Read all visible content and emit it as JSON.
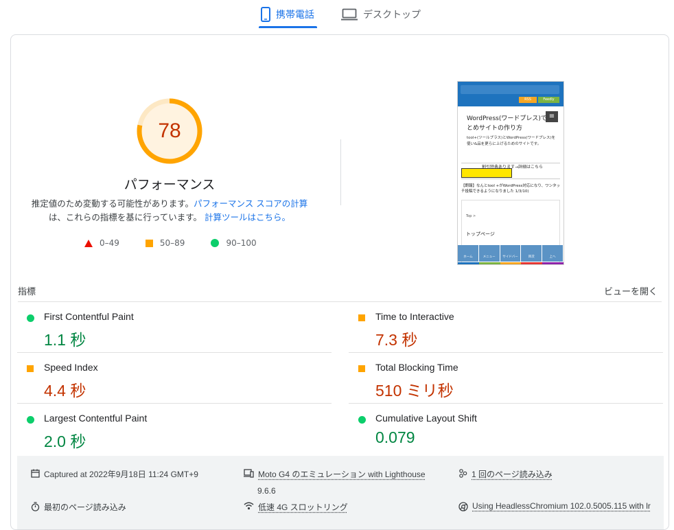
{
  "tabs": {
    "mobile": "携帯電話",
    "desktop": "デスクトップ"
  },
  "performance": {
    "score": "78",
    "score_value": 78,
    "title": "パフォーマンス",
    "desc_1": "推定値のため変動する可能性があります。",
    "desc_link_1": "パフォーマンス スコアの計算",
    "desc_2": "は、これらの指標を基に行っています。",
    "desc_link_2": "計算ツールはこちら。",
    "legend": [
      {
        "range": "0–49"
      },
      {
        "range": "50–89"
      },
      {
        "range": "90–100"
      }
    ]
  },
  "screenshot": {
    "title": "WordPress(ワードプレス)でまとめサイトの作り方",
    "subtitle": "tool+(ツールプラス)とWordPress(ワードプレス)を使い&品を更らに上げるためのサイトです。",
    "banner": "割引特典あります→詳細はこちら",
    "note": "【朗報】なんとtool +がWordPress対応になり、ワンタッチ投稿できるようになりました 1/3/10)",
    "breadcrumb": "Top >",
    "page": "トップページ",
    "btn_rss": "RSS",
    "btn_feedly": "Feedly",
    "nav": [
      "ホーム",
      "メニュー",
      "サイドバー",
      "目次",
      "上へ"
    ]
  },
  "metrics": {
    "label": "指標",
    "expand": "ビューを開く",
    "items": [
      {
        "name": "First Contentful Paint",
        "value": "1.1 秒",
        "rating": "good"
      },
      {
        "name": "Time to Interactive",
        "value": "7.3 秒",
        "rating": "average"
      },
      {
        "name": "Speed Index",
        "value": "4.4 秒",
        "rating": "average"
      },
      {
        "name": "Total Blocking Time",
        "value": "510 ミリ秒",
        "rating": "average"
      },
      {
        "name": "Largest Contentful Paint",
        "value": "2.0 秒",
        "rating": "good"
      },
      {
        "name": "Cumulative Layout Shift",
        "value": "0.079",
        "rating": "good"
      }
    ]
  },
  "footer": {
    "captured": "Captured at 2022年9月18日 11:24 GMT+9",
    "device": "Moto G4 のエミュレーション with Lighthouse",
    "version": "9.6.6",
    "loads": "1 回のページ読み込み",
    "initial": "最初のページ読み込み",
    "throttle": "低速 4G スロットリング",
    "browser": "Using HeadlessChromium 102.0.5005.115 with lr"
  },
  "colors": {
    "accent": "#1a73e8",
    "good": "#018642",
    "average": "#c33300",
    "orange": "#ffa400",
    "green": "#0cce6b",
    "red": "#eb0f00"
  }
}
